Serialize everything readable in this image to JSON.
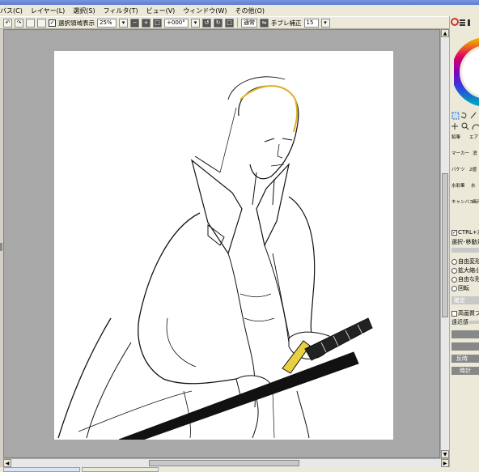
{
  "menu": {
    "items": [
      "バス(C)",
      "レイヤー(L)",
      "選択(S)",
      "フィルタ(T)",
      "ビュー(V)",
      "ウィンドウ(W)",
      "その他(O)"
    ]
  },
  "toolbar": {
    "show_selection_label": "選択領域表示",
    "zoom_value": "25%",
    "rotation_value": "+000°",
    "mode_label": "通常",
    "stabilizer_label": "手ブレ補正",
    "stabilizer_value": "15",
    "checkmark": "✓"
  },
  "panel": {
    "tools": [
      {
        "label": "鉛筆"
      },
      {
        "label": "エア"
      },
      {
        "label": "マーカー"
      },
      {
        "label": "消"
      },
      {
        "label": "バケツ"
      },
      {
        "label": "2値"
      },
      {
        "label": "水彩筆"
      },
      {
        "label": "水"
      },
      {
        "label": "キャンバス"
      },
      {
        "label": "画用"
      }
    ],
    "ctrl_label": "CTRL+左",
    "move_label": "選択･移動対",
    "radio_options": [
      "自由変形",
      "拡大縮小",
      "自由な形",
      "回転"
    ],
    "confirm_label": "確定",
    "quality_label": "高画質プ",
    "perspective_label": "遠近感",
    "flip_h_label": "反時",
    "flip_v_label": "時計"
  },
  "colors": {
    "canvas_bg": "#a8a8a8",
    "paper": "#ffffff",
    "title_blue": "#5a7bd4",
    "sword_guard": "#e8d040"
  }
}
